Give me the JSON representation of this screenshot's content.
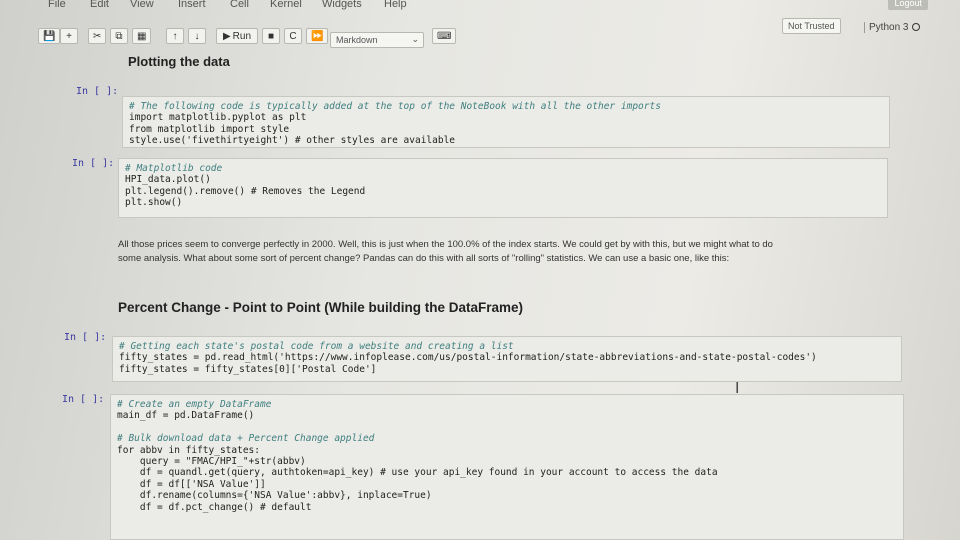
{
  "menubar": {
    "items": [
      "File",
      "Edit",
      "View",
      "Insert",
      "Cell",
      "Kernel",
      "Widgets",
      "Help"
    ],
    "logout_label": "Logout"
  },
  "toolbar": {
    "run_label": "Run",
    "cell_type": "Markdown"
  },
  "status": {
    "trusted": "Not Trusted",
    "kernel": "Python 3"
  },
  "cells": {
    "heading1": "Plotting the data",
    "prompt_empty": "In [ ]:",
    "code1": [
      "# The following code is typically added at the top of the NoteBook with all the other imports",
      "import matplotlib.pyplot as plt",
      "from matplotlib import style",
      "style.use('fivethirtyeight') # other styles are available"
    ],
    "code2": [
      "# Matplotlib code",
      "HPI_data.plot()",
      "plt.legend().remove() # Removes the Legend",
      "plt.show()"
    ],
    "paragraph1_line1": "All those prices seem to converge perfectly in 2000. Well, this is just when the 100.0% of the index starts. We could get by with this, but we might what to do",
    "paragraph1_line2": "some analysis. What about some sort of percent change? Pandas can do this with all sorts of \"rolling\" statistics. We can use a basic one, like this:",
    "heading2": "Percent Change - Point to Point (While building the DataFrame)",
    "code3": [
      "# Getting each state's postal code from a website and creating a list",
      "fifty_states = pd.read_html('https://www.infoplease.com/us/postal-information/state-abbreviations-and-state-postal-codes')",
      "fifty_states = fifty_states[0]['Postal Code']"
    ],
    "code4": [
      "# Create an empty DataFrame",
      "main_df = pd.DataFrame()",
      "",
      "# Bulk download data + Percent Change applied",
      "for abbv in fifty_states:",
      "    query = \"FMAC/HPI_\"+str(abbv)",
      "    df = quandl.get(query, authtoken=api_key) # use your api_key found in your account to access the data",
      "    df = df[['NSA Value']]",
      "    df.rename(columns={'NSA Value':abbv}, inplace=True)",
      "    df = df.pct_change() # default"
    ]
  }
}
